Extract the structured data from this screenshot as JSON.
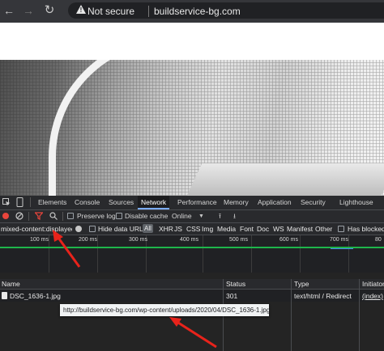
{
  "browser": {
    "security_label": "Not secure",
    "url": "buildservice-bg.com"
  },
  "devtools": {
    "tabs": [
      "Elements",
      "Console",
      "Sources",
      "Network",
      "Performance",
      "Memory",
      "Application",
      "Security",
      "Lighthouse"
    ],
    "active_tab": "Network",
    "toolbar": {
      "preserve_log": "Preserve log",
      "disable_cache": "Disable cache",
      "throttling": "Online"
    },
    "filter": {
      "value": "mixed-content:displayed",
      "hide_data_urls": "Hide data URLs",
      "types": [
        "All",
        "XHR",
        "JS",
        "CSS",
        "Img",
        "Media",
        "Font",
        "Doc",
        "WS",
        "Manifest",
        "Other"
      ],
      "has_blocked": "Has blocked"
    },
    "timeline_ticks": [
      "100 ms",
      "200 ms",
      "300 ms",
      "400 ms",
      "500 ms",
      "600 ms",
      "700 ms",
      "80"
    ],
    "table": {
      "headers": [
        "Name",
        "Status",
        "Type",
        "Initiator"
      ],
      "rows": [
        {
          "name": "DSC_1636-1.jpg",
          "status": "301",
          "type": "text/html / Redirect",
          "initiator": "(index)"
        }
      ]
    },
    "tooltip": "http://buildservice-bg.com/wp-content/uploads/2020/04/DSC_1636-1.jpg"
  },
  "colors": {
    "annotation_arrow": "#e8231b",
    "timeline_green": "#1eb54b",
    "timeline_blue": "#4a8cf0",
    "tab_highlight": "#7cacf8"
  }
}
